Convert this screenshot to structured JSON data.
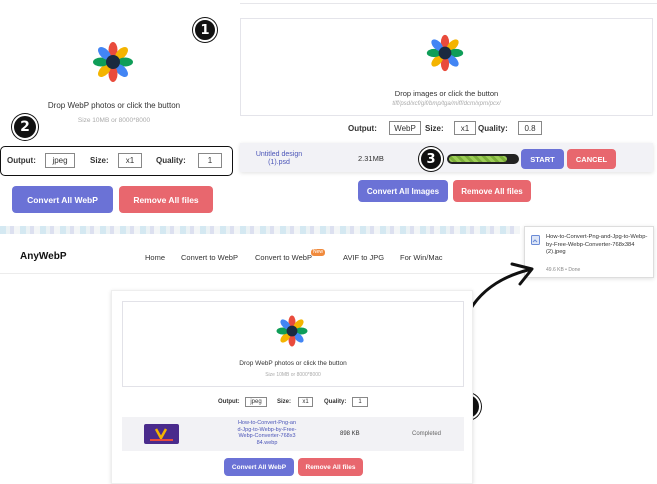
{
  "panel1": {
    "drop_text": "Drop WebP photos or click the button",
    "size_hint": "Size 10MB or 8000*8000",
    "output_label": "Output:",
    "output_value": "jpeg",
    "size_label": "Size:",
    "size_value": "x1",
    "quality_label": "Quality:",
    "quality_value": "1",
    "convert_label": "Convert All WebP",
    "remove_label": "Remove All files"
  },
  "panel2": {
    "drop_text": "Drop images or click the button",
    "formats_hint": "tiff/psd/xcf/gif/bmp/tga/miff/dcm/xpm/pcx/",
    "output_label": "Output:",
    "output_value": "WebP",
    "size_label": "Size:",
    "size_value": "x1",
    "quality_label": "Quality:",
    "quality_value": "0.8",
    "file_name": "Untitled design (1).psd",
    "file_size": "2.31MB",
    "progress": 0.85,
    "start_label": "START",
    "cancel_label": "CANCEL",
    "convert_label": "Convert All Images",
    "remove_label": "Remove All files"
  },
  "nav": {
    "logo": "AnyWebP",
    "links": [
      "Home",
      "Convert to WebP",
      "Convert to WebP",
      "AVIF to JPG",
      "For Win/Mac"
    ],
    "new_badge": "New"
  },
  "download": {
    "file_name": "How-to-Convert-Png-and-Jpg-to-Webp-by-Free-Webp-Converter-768x384 (2).jpeg",
    "status": "49.6 KB • Done"
  },
  "panel3": {
    "drop_text": "Drop WebP photos or click the button",
    "size_hint": "Size 10MB or 8000*8000",
    "output_label": "Output:",
    "output_value": "jpeg",
    "size_label": "Size:",
    "size_value": "x1",
    "quality_label": "Quality:",
    "quality_value": "1",
    "file_name": "How-to-Convert-Png-and-Jpg-to-Webp-by-Free-Webp-Converter-768x384.webp",
    "file_size": "898 KB",
    "file_status": "Completed",
    "convert_label": "Convert All WebP",
    "remove_label": "Remove All files"
  },
  "badges": [
    "1",
    "2",
    "3",
    "4"
  ],
  "colors": {
    "primary": "#6b72d6",
    "danger": "#e8676e",
    "progress": "#8cc04a"
  }
}
